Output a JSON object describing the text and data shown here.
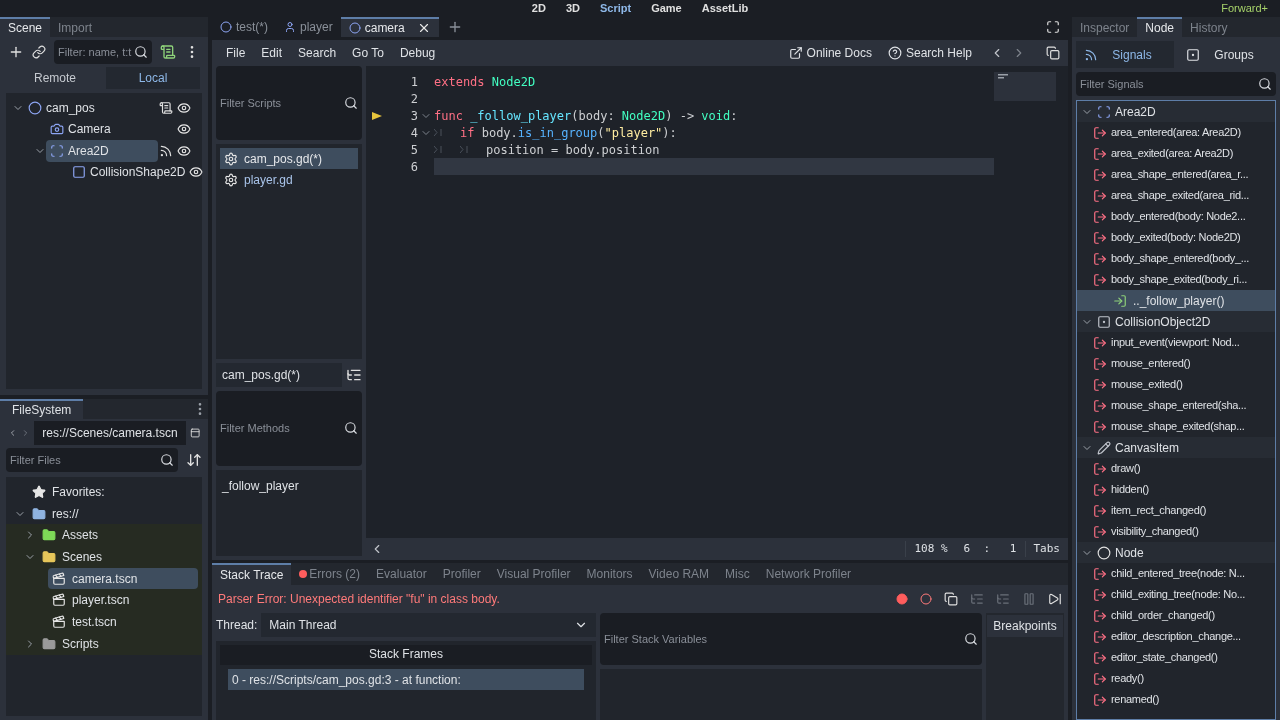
{
  "workspaces": [
    {
      "label": "2D",
      "selected": false
    },
    {
      "label": "3D",
      "selected": false
    },
    {
      "label": "Script",
      "selected": true
    },
    {
      "label": "Game",
      "selected": false
    },
    {
      "label": "AssetLib",
      "selected": false
    }
  ],
  "renderer": "Forward+",
  "scene_dock": {
    "tabs": [
      {
        "label": "Scene",
        "selected": true
      },
      {
        "label": "Import",
        "selected": false
      }
    ],
    "filter_placeholder": "Filter: name, t:t",
    "modes": [
      {
        "label": "Remote",
        "selected": false
      },
      {
        "label": "Local",
        "selected": true
      }
    ],
    "tree": [
      {
        "name": "cam_pos",
        "kind": "node2d",
        "selected": false,
        "script": true,
        "signals": false,
        "visible": true,
        "children": [
          {
            "name": "Camera",
            "kind": "camera",
            "selected": false,
            "script": false,
            "signals": false,
            "visible": true
          },
          {
            "name": "Area2D",
            "kind": "area",
            "selected": true,
            "script": false,
            "signals": true,
            "visible": true,
            "children": [
              {
                "name": "CollisionShape2D",
                "kind": "shape",
                "selected": false,
                "script": false,
                "signals": false,
                "visible": true
              }
            ]
          }
        ]
      }
    ]
  },
  "filesystem": {
    "title": "FileSystem",
    "path": "res://Scenes/camera.tscn",
    "filter_placeholder": "Filter Files",
    "tree": [
      {
        "name": "Favorites:",
        "kind": "favorites",
        "selected": false
      },
      {
        "name": "res://",
        "kind": "root",
        "selected": false,
        "expanded": true,
        "children": [
          {
            "name": "Assets",
            "kind": "assets",
            "selected": false,
            "expanded": false
          },
          {
            "name": "Scenes",
            "kind": "folder",
            "selected": false,
            "expanded": true,
            "children": [
              {
                "name": "camera.tscn",
                "kind": "scene",
                "selected": true
              },
              {
                "name": "player.tscn",
                "kind": "scene",
                "selected": false
              },
              {
                "name": "test.tscn",
                "kind": "scene",
                "selected": false
              }
            ]
          },
          {
            "name": "Scripts",
            "kind": "plain",
            "selected": false,
            "expanded": false
          }
        ]
      }
    ]
  },
  "editor_tabs": [
    {
      "label": "test(*)",
      "kind": "node2d",
      "selected": false
    },
    {
      "label": "player",
      "kind": "player",
      "selected": false
    },
    {
      "label": "camera",
      "kind": "node2d",
      "selected": true
    }
  ],
  "menu": [
    "File",
    "Edit",
    "Search",
    "Go To",
    "Debug"
  ],
  "help_buttons": [
    {
      "label": "Online Docs",
      "kind": "docs"
    },
    {
      "label": "Search Help",
      "kind": "help"
    }
  ],
  "scripts": {
    "filter_placeholder": "Filter Scripts",
    "items": [
      {
        "name": "cam_pos.gd(*)",
        "selected": true
      },
      {
        "name": "player.gd",
        "selected": false
      }
    ],
    "current": "cam_pos.gd(*)",
    "methods_placeholder": "Filter Methods",
    "methods": [
      "_follow_player"
    ]
  },
  "code": [
    {
      "number": "1",
      "fold": false,
      "current": false,
      "caret": false,
      "tokens": [
        {
          "kind": "keyword",
          "text": "extends "
        },
        {
          "kind": "type",
          "text": "Node2D"
        }
      ]
    },
    {
      "number": "2",
      "fold": false,
      "current": false,
      "caret": false
    },
    {
      "number": "3",
      "fold": true,
      "current": true,
      "caret": false,
      "tokens": [
        {
          "kind": "keyword",
          "text": "func "
        },
        {
          "kind": "function",
          "text": "_follow_player"
        },
        {
          "kind": "text",
          "text": "(body: "
        },
        {
          "kind": "type",
          "text": "Node2D"
        },
        {
          "kind": "text",
          "text": ") -> "
        },
        {
          "kind": "type",
          "text": "void"
        },
        {
          "kind": "text",
          "text": ":"
        }
      ]
    },
    {
      "number": "4",
      "fold": true,
      "current": false,
      "caret": false,
      "tokens": [
        {
          "kind": "tab"
        },
        {
          "kind": "keyword",
          "text": "if"
        },
        {
          "kind": "text",
          "text": " body."
        },
        {
          "kind": "call",
          "text": "is_in_group"
        },
        {
          "kind": "text",
          "text": "("
        },
        {
          "kind": "string",
          "text": "\"player\""
        },
        {
          "kind": "text",
          "text": "):"
        }
      ]
    },
    {
      "number": "5",
      "fold": false,
      "current": false,
      "caret": false,
      "tokens": [
        {
          "kind": "tab"
        },
        {
          "kind": "tab"
        },
        {
          "kind": "text",
          "text": "position = body.position"
        }
      ]
    },
    {
      "number": "6",
      "fold": false,
      "current": false,
      "caret": true
    }
  ],
  "status": {
    "zoom": "108 %",
    "position": "6  :   1",
    "indent": "Tabs"
  },
  "bottom": {
    "tabs": [
      {
        "label": "Stack Trace",
        "selected": true,
        "error_dot": false
      },
      {
        "label": "Errors (2)",
        "selected": false,
        "error_dot": true
      },
      {
        "label": "Evaluator",
        "selected": false,
        "error_dot": false
      },
      {
        "label": "Profiler",
        "selected": false,
        "error_dot": false
      },
      {
        "label": "Visual Profiler",
        "selected": false,
        "error_dot": false
      },
      {
        "label": "Monitors",
        "selected": false,
        "error_dot": false
      },
      {
        "label": "Video RAM",
        "selected": false,
        "error_dot": false
      },
      {
        "label": "Misc",
        "selected": false,
        "error_dot": false
      },
      {
        "label": "Network Profiler",
        "selected": false,
        "error_dot": false
      }
    ],
    "error": "Parser Error: Unexpected identifier \"fu\" in class body.",
    "thread_label": "Thread:",
    "thread": "Main Thread",
    "variables_placeholder": "Filter Stack Variables",
    "breakpoints": "Breakpoints",
    "frames_header": "Stack Frames",
    "frames": [
      {
        "text": "0 - res://Scripts/cam_pos.gd:3 - at function:",
        "selected": true
      }
    ]
  },
  "right_dock": {
    "tabs": [
      {
        "label": "Inspector",
        "selected": false
      },
      {
        "label": "Node",
        "selected": true
      },
      {
        "label": "History",
        "selected": false
      }
    ],
    "subtabs": [
      {
        "label": "Signals",
        "kind": "signals",
        "selected": true
      },
      {
        "label": "Groups",
        "kind": "groups",
        "selected": false
      }
    ],
    "filter_placeholder": "Filter Signals",
    "classes": [
      {
        "name": "Area2D",
        "kind": "area",
        "signals": [
          {
            "text": "area_entered(area: Area2D)",
            "selected": false
          },
          {
            "text": "area_exited(area: Area2D)",
            "selected": false
          },
          {
            "text": "area_shape_entered(area_r...",
            "selected": false
          },
          {
            "text": "area_shape_exited(area_rid...",
            "selected": false
          },
          {
            "text": "body_entered(body: Node2...",
            "selected": false
          },
          {
            "text": "body_exited(body: Node2D)",
            "selected": false
          },
          {
            "text": "body_shape_entered(body_...",
            "selected": false
          },
          {
            "text": "body_shape_exited(body_ri...",
            "selected": false,
            "connections": [
              {
                "text": ".._follow_player()",
                "selected": true
              }
            ]
          }
        ]
      },
      {
        "name": "CollisionObject2D",
        "kind": "collision",
        "signals": [
          {
            "text": "input_event(viewport: Nod...",
            "selected": false
          },
          {
            "text": "mouse_entered()",
            "selected": false
          },
          {
            "text": "mouse_exited()",
            "selected": false
          },
          {
            "text": "mouse_shape_entered(sha...",
            "selected": false
          },
          {
            "text": "mouse_shape_exited(shap...",
            "selected": false
          }
        ]
      },
      {
        "name": "CanvasItem",
        "kind": "canvas",
        "signals": [
          {
            "text": "draw()",
            "selected": false
          },
          {
            "text": "hidden()",
            "selected": false
          },
          {
            "text": "item_rect_changed()",
            "selected": false
          },
          {
            "text": "visibility_changed()",
            "selected": false
          }
        ]
      },
      {
        "name": "Node",
        "kind": "node",
        "signals": [
          {
            "text": "child_entered_tree(node: N...",
            "selected": false
          },
          {
            "text": "child_exiting_tree(node: No...",
            "selected": false
          },
          {
            "text": "child_order_changed()",
            "selected": false
          },
          {
            "text": "editor_description_change...",
            "selected": false
          },
          {
            "text": "editor_state_changed()",
            "selected": false
          },
          {
            "text": "ready()",
            "selected": false
          },
          {
            "text": "renamed()",
            "selected": false
          }
        ]
      }
    ]
  }
}
